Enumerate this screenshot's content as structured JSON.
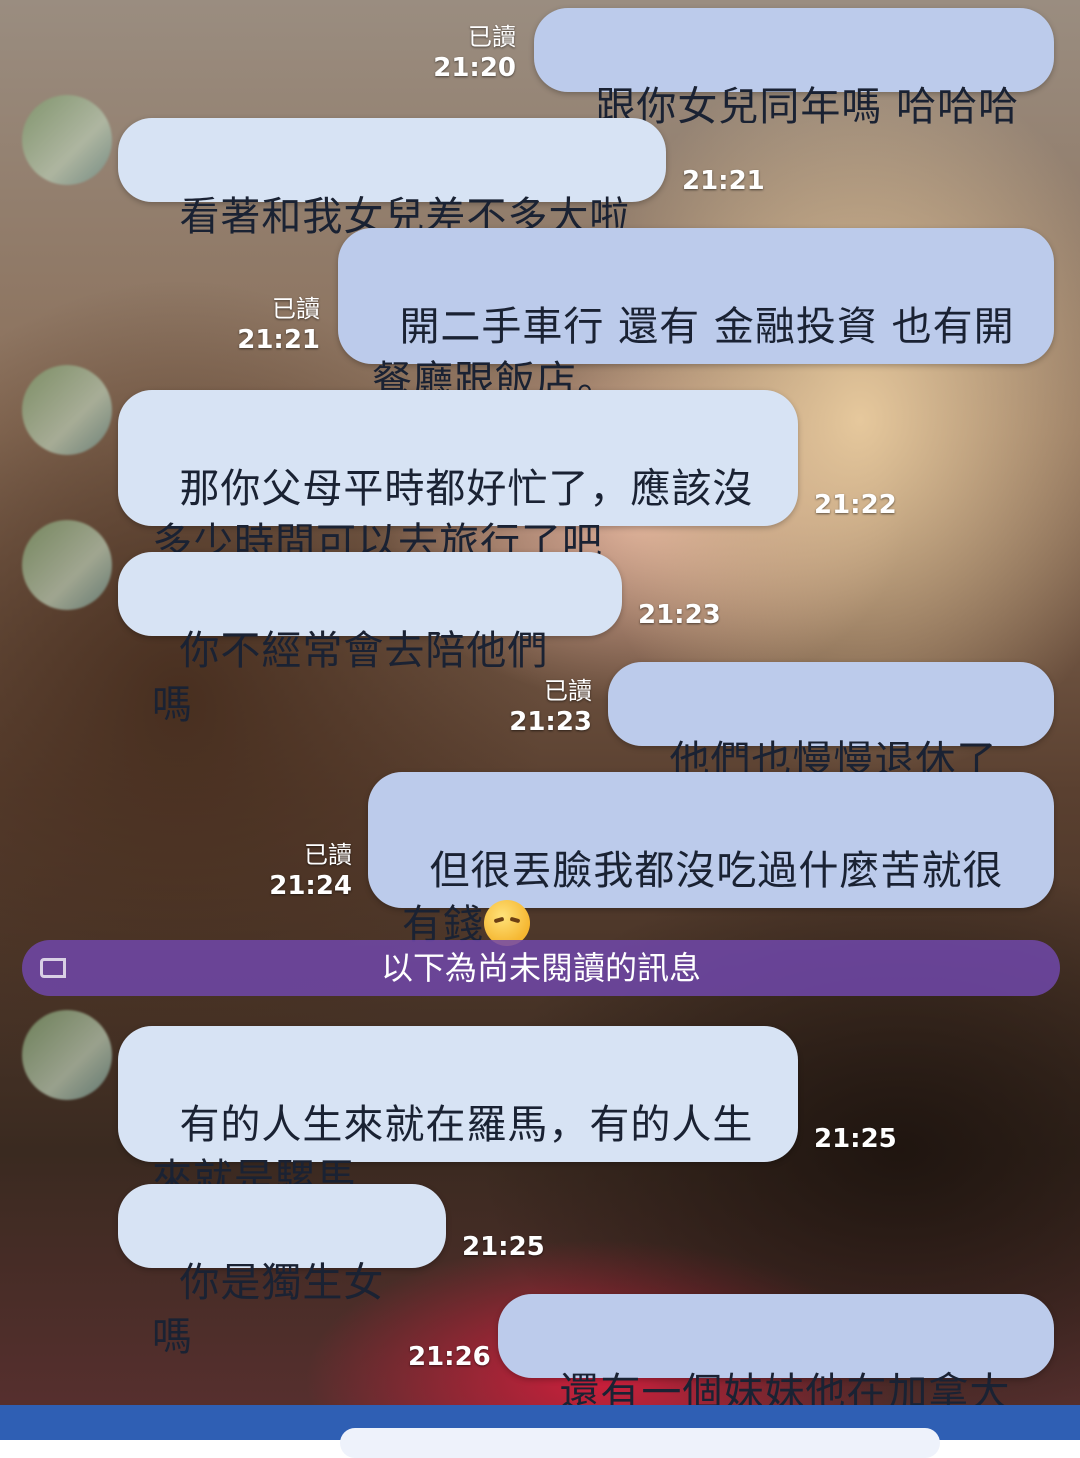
{
  "messages": [
    {
      "id": "m1",
      "dir": "out",
      "text": "跟你女兒同年嗎 哈哈哈",
      "read": "已讀",
      "time": "21:20"
    },
    {
      "id": "m2",
      "dir": "in",
      "text": "看著和我女兒差不多大啦",
      "time": "21:21"
    },
    {
      "id": "m3",
      "dir": "out",
      "text": "開二手車行 還有 金融投資 也有開餐廳跟飯店。",
      "read": "已讀",
      "time": "21:21"
    },
    {
      "id": "m4",
      "dir": "in",
      "text": "那你父母平時都好忙了，應該沒多少時間可以去旅行了吧",
      "time": "21:22"
    },
    {
      "id": "m5",
      "dir": "in",
      "text": "你不經常會去陪他們嗎",
      "time": "21:23"
    },
    {
      "id": "m6",
      "dir": "out",
      "text": "他們也慢慢退休了",
      "read": "已讀",
      "time": "21:23"
    },
    {
      "id": "m7",
      "dir": "out",
      "text": "但很丟臉我都沒吃過什麼苦就很有錢",
      "emoji": "pensive-face-emoji",
      "read": "已讀",
      "time": "21:24"
    },
    {
      "id": "m8",
      "dir": "in",
      "text": "有的人生來就在羅馬，有的人生來就是騾馬",
      "time": "21:25"
    },
    {
      "id": "m9",
      "dir": "in",
      "text": "你是獨生女嗎",
      "time": "21:25"
    },
    {
      "id": "m10",
      "dir": "out",
      "text": "還有一個妹妹他在加拿大",
      "time": "21:26"
    }
  ],
  "unread_banner": "以下為尚未閱讀的訊息",
  "icons": {
    "unread_tag": "tag-icon",
    "avatar": "contact-avatar"
  },
  "colors": {
    "bubble_in": "#d7e3f4",
    "bubble_out": "#bccbeb",
    "banner": "#7048aa",
    "bottom_bar": "#2f5fb4"
  }
}
